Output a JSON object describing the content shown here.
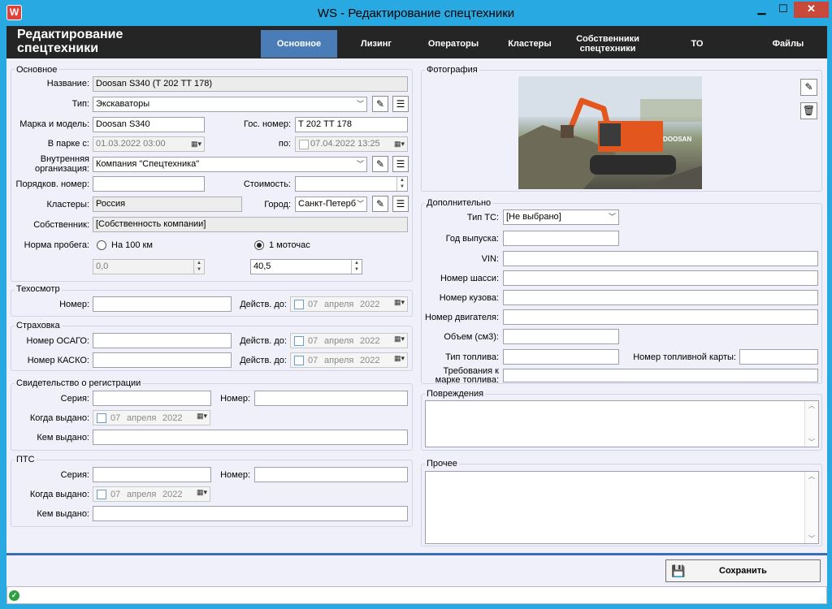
{
  "window": {
    "title": "WS - Редактирование спецтехники",
    "app_icon": "W",
    "min": "▁",
    "max": "☐",
    "close": "✕"
  },
  "header": {
    "title": "Редактирование спецтехники"
  },
  "tabs": [
    {
      "label": "Основное"
    },
    {
      "label": "Лизинг"
    },
    {
      "label": "Операторы"
    },
    {
      "label": "Кластеры"
    },
    {
      "label": "Собственники спецтехники"
    },
    {
      "label": "ТО"
    },
    {
      "label": "Файлы"
    }
  ],
  "main": {
    "group_title": "Основное",
    "name_label": "Название:",
    "name_value": "Doosan S340 (Т 202 ТТ 178)",
    "type_label": "Тип:",
    "type_value": "Экскаваторы",
    "brand_label": "Марка и модель:",
    "brand_value": "Doosan S340",
    "gos_label": "Гос. номер:",
    "gos_value": "Т 202 ТТ 178",
    "park_from_label": "В парке с:",
    "park_from_value": "01.03.2022 03:00",
    "park_to_label": "по:",
    "park_to_value": "07.04.2022 13:25",
    "org_label": "Внутренняя организация:",
    "org_value": "Компания \"Спецтехника\"",
    "order_label": "Порядков. номер:",
    "order_value": "",
    "cost_label": "Стоимость:",
    "cost_value": "",
    "clusters_label": "Кластеры:",
    "clusters_value": "Россия",
    "city_label": "Город:",
    "city_value": "Санкт-Петерб",
    "owner_label": "Собственник:",
    "owner_value": "[Собственность компании]",
    "mileage_label": "Норма пробега:",
    "per100_label": "На 100 км",
    "per100_value": "0,0",
    "perhour_label": "1 моточас",
    "perhour_value": "40,5"
  },
  "inspection": {
    "title": "Техосмотр",
    "number_label": "Номер:",
    "valid_label": "Действ. до:",
    "date_day": "07",
    "date_month": "апреля",
    "date_year": "2022"
  },
  "insurance": {
    "title": "Страховка",
    "osago_label": "Номер ОСАГО:",
    "kasko_label": "Номер КАСКО:",
    "valid_label": "Действ. до:",
    "date_day": "07",
    "date_month": "апреля",
    "date_year": "2022"
  },
  "registration": {
    "title": "Свидетельство о регистрации",
    "series_label": "Серия:",
    "number_label": "Номер:",
    "issued_when_label": "Когда выдано:",
    "issued_by_label": "Кем выдано:",
    "date_day": "07",
    "date_month": "апреля",
    "date_year": "2022"
  },
  "pts": {
    "title": "ПТС",
    "series_label": "Серия:",
    "number_label": "Номер:",
    "issued_when_label": "Когда выдано:",
    "issued_by_label": "Кем выдано:",
    "date_day": "07",
    "date_month": "апреля",
    "date_year": "2022"
  },
  "photo": {
    "title": "Фотография",
    "brand_text": "DOOSAN"
  },
  "extra": {
    "title": "Дополнительно",
    "vehicle_type_label": "Тип ТС:",
    "vehicle_type_value": "[Не выбрано]",
    "year_label": "Год выпуска:",
    "vin_label": "VIN:",
    "chassis_label": "Номер шасси:",
    "body_label": "Номер кузова:",
    "engine_label": "Номер двигателя:",
    "volume_label": "Объем (см3):",
    "fuel_type_label": "Тип топлива:",
    "fuel_card_label": "Номер топливной карты:",
    "fuel_req_label": "Требования к марке топлива:"
  },
  "damage": {
    "title": "Повреждения"
  },
  "other": {
    "title": "Прочее"
  },
  "save": {
    "label": "Сохранить"
  },
  "status": {
    "icon": "✓"
  }
}
